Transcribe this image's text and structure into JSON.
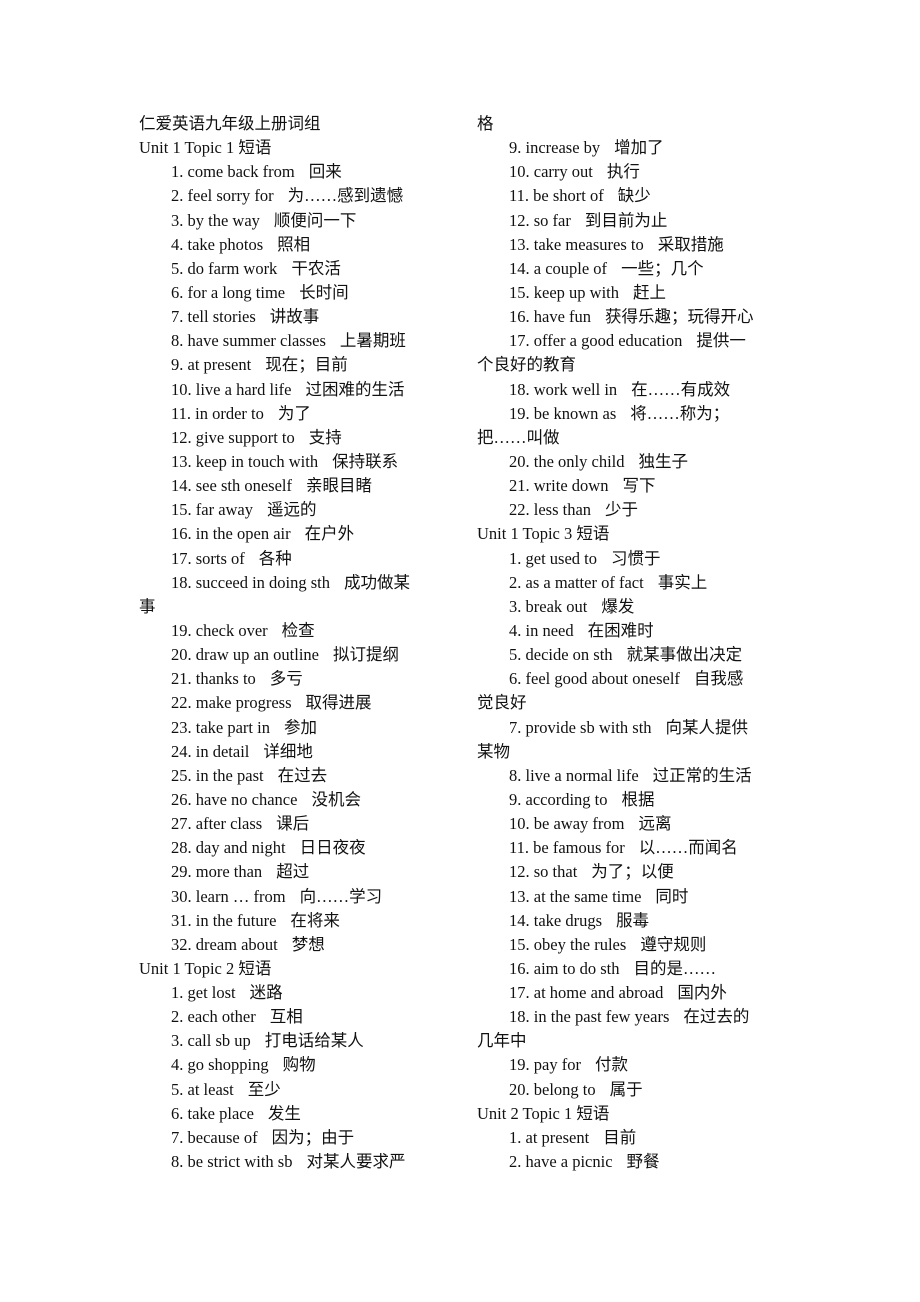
{
  "document": {
    "title": "仁爱英语九年级上册词组",
    "left_column": [
      {
        "type": "title",
        "text": "仁爱英语九年级上册词组"
      },
      {
        "type": "heading",
        "text": "Unit 1 Topic 1 短语"
      },
      {
        "type": "item",
        "num": "1.",
        "en": "come back from",
        "cn": "回来"
      },
      {
        "type": "item",
        "num": "2.",
        "en": "feel sorry for",
        "cn": "为……感到遗憾"
      },
      {
        "type": "item",
        "num": "3.",
        "en": "by the way",
        "cn": "顺便问一下"
      },
      {
        "type": "item",
        "num": "4.",
        "en": "take photos",
        "cn": "照相"
      },
      {
        "type": "item",
        "num": "5.",
        "en": "do farm work",
        "cn": "干农活"
      },
      {
        "type": "item",
        "num": "6.",
        "en": "for a long time",
        "cn": "长时间"
      },
      {
        "type": "item",
        "num": "7.",
        "en": "tell stories",
        "cn": "讲故事"
      },
      {
        "type": "item",
        "num": "8.",
        "en": "have summer classes",
        "cn": "上暑期班"
      },
      {
        "type": "item",
        "num": "9.",
        "en": "at present",
        "cn": "现在；目前"
      },
      {
        "type": "item",
        "num": "10.",
        "en": "live a hard life",
        "cn": "过困难的生活"
      },
      {
        "type": "item",
        "num": "11.",
        "en": "in order to",
        "cn": "为了"
      },
      {
        "type": "item",
        "num": "12.",
        "en": "give support to",
        "cn": "支持"
      },
      {
        "type": "item",
        "num": "13.",
        "en": "keep in touch with",
        "cn": "保持联系"
      },
      {
        "type": "item",
        "num": "14.",
        "en": "see sth oneself",
        "cn": "亲眼目睹"
      },
      {
        "type": "item",
        "num": "15.",
        "en": "far away",
        "cn": "遥远的"
      },
      {
        "type": "item",
        "num": "16.",
        "en": "in the open air",
        "cn": "在户外"
      },
      {
        "type": "item",
        "num": "17.",
        "en": "sorts of",
        "cn": "各种"
      },
      {
        "type": "item",
        "num": "18.",
        "en": "succeed in doing sth",
        "cn": "成功做某"
      },
      {
        "type": "wrap",
        "text": "事"
      },
      {
        "type": "item",
        "num": "19.",
        "en": "check over",
        "cn": "检查"
      },
      {
        "type": "item",
        "num": "20.",
        "en": "draw up an outline",
        "cn": "拟订提纲"
      },
      {
        "type": "item",
        "num": "21.",
        "en": "thanks to",
        "cn": "多亏"
      },
      {
        "type": "item",
        "num": "22.",
        "en": "make progress",
        "cn": "取得进展"
      },
      {
        "type": "item",
        "num": "23.",
        "en": "take part in",
        "cn": "参加"
      },
      {
        "type": "item",
        "num": "24.",
        "en": "in detail",
        "cn": "详细地"
      },
      {
        "type": "item",
        "num": "25.",
        "en": "in the past",
        "cn": "在过去"
      },
      {
        "type": "item",
        "num": "26.",
        "en": "have no chance",
        "cn": "没机会"
      },
      {
        "type": "item",
        "num": "27.",
        "en": "after class",
        "cn": "课后"
      },
      {
        "type": "item",
        "num": "28.",
        "en": "day and night",
        "cn": "日日夜夜"
      },
      {
        "type": "item",
        "num": "29.",
        "en": "more than",
        "cn": "超过"
      },
      {
        "type": "item",
        "num": "30.",
        "en": "learn … from",
        "cn": "向……学习"
      },
      {
        "type": "item",
        "num": "31.",
        "en": "in the future",
        "cn": "在将来"
      },
      {
        "type": "item",
        "num": "32.",
        "en": "dream about",
        "cn": "梦想"
      },
      {
        "type": "heading",
        "text": "Unit 1 Topic 2 短语"
      },
      {
        "type": "item",
        "num": "1.",
        "en": "get lost",
        "cn": "迷路"
      },
      {
        "type": "item",
        "num": "2.",
        "en": "each other",
        "cn": "互相"
      },
      {
        "type": "item",
        "num": "3.",
        "en": "call sb up",
        "cn": "打电话给某人"
      },
      {
        "type": "item",
        "num": "4.",
        "en": "go shopping",
        "cn": "购物"
      },
      {
        "type": "item",
        "num": "5.",
        "en": "at least",
        "cn": "至少"
      },
      {
        "type": "item",
        "num": "6.",
        "en": "take place",
        "cn": "发生"
      },
      {
        "type": "item",
        "num": "7.",
        "en": "because of",
        "cn": "因为；由于"
      },
      {
        "type": "item",
        "num": "8.",
        "en": "be strict with sb",
        "cn": "对某人要求严"
      }
    ],
    "right_column": [
      {
        "type": "wrap",
        "text": "格"
      },
      {
        "type": "item",
        "num": "9.",
        "en": "increase by",
        "cn": "增加了"
      },
      {
        "type": "item",
        "num": "10.",
        "en": "carry out",
        "cn": "执行"
      },
      {
        "type": "item",
        "num": "11.",
        "en": "be short of",
        "cn": "缺少"
      },
      {
        "type": "item",
        "num": "12.",
        "en": "so far",
        "cn": "到目前为止"
      },
      {
        "type": "item",
        "num": "13.",
        "en": "take measures to",
        "cn": "采取措施"
      },
      {
        "type": "item",
        "num": "14.",
        "en": "a couple of",
        "cn": "一些；几个"
      },
      {
        "type": "item",
        "num": "15.",
        "en": "keep up with",
        "cn": "赶上"
      },
      {
        "type": "item",
        "num": "16.",
        "en": "have fun",
        "cn": "获得乐趣；玩得开心"
      },
      {
        "type": "item",
        "num": "17.",
        "en": "offer a good education",
        "cn": "提供一"
      },
      {
        "type": "wrap",
        "text": "个良好的教育"
      },
      {
        "type": "item",
        "num": "18.",
        "en": "work well in",
        "cn": "在……有成效"
      },
      {
        "type": "item",
        "num": "19.",
        "en": "be known as",
        "cn": "将……称为；"
      },
      {
        "type": "wrap",
        "text": "把……叫做"
      },
      {
        "type": "item",
        "num": "20.",
        "en": "the only child",
        "cn": "独生子"
      },
      {
        "type": "item",
        "num": "21.",
        "en": "write down",
        "cn": "写下"
      },
      {
        "type": "item",
        "num": "22.",
        "en": "less than",
        "cn": "少于"
      },
      {
        "type": "heading",
        "text": "Unit 1 Topic 3 短语"
      },
      {
        "type": "item",
        "num": "1.",
        "en": "get used to",
        "cn": "习惯于"
      },
      {
        "type": "item",
        "num": "2.",
        "en": "as a matter of fact",
        "cn": "事实上"
      },
      {
        "type": "item",
        "num": "3.",
        "en": "break out",
        "cn": "爆发"
      },
      {
        "type": "item",
        "num": "4.",
        "en": "in need",
        "cn": "在困难时"
      },
      {
        "type": "item",
        "num": "5.",
        "en": "decide on sth",
        "cn": "就某事做出决定"
      },
      {
        "type": "item",
        "num": "6.",
        "en": "feel good about oneself",
        "cn": "自我感"
      },
      {
        "type": "wrap",
        "text": "觉良好"
      },
      {
        "type": "item",
        "num": "7.",
        "en": "provide sb with sth",
        "cn": "向某人提供"
      },
      {
        "type": "wrap",
        "text": "某物"
      },
      {
        "type": "item",
        "num": "8.",
        "en": "live a normal life",
        "cn": "过正常的生活"
      },
      {
        "type": "item",
        "num": "9.",
        "en": "according to",
        "cn": "根据"
      },
      {
        "type": "item",
        "num": "10.",
        "en": "be away from",
        "cn": "远离"
      },
      {
        "type": "item",
        "num": "11.",
        "en": "be famous for",
        "cn": "以……而闻名"
      },
      {
        "type": "item",
        "num": "12.",
        "en": "so that",
        "cn": "为了；以便"
      },
      {
        "type": "item",
        "num": "13.",
        "en": "at the same time",
        "cn": "同时"
      },
      {
        "type": "item",
        "num": "14.",
        "en": "take drugs",
        "cn": "服毒"
      },
      {
        "type": "item",
        "num": "15.",
        "en": "obey the rules",
        "cn": "遵守规则"
      },
      {
        "type": "item",
        "num": "16.",
        "en": "aim to do sth",
        "cn": "目的是……"
      },
      {
        "type": "item",
        "num": "17.",
        "en": "at home and abroad",
        "cn": "国内外"
      },
      {
        "type": "item",
        "num": "18.",
        "en": "in the past few years",
        "cn": "在过去的"
      },
      {
        "type": "wrap",
        "text": "几年中"
      },
      {
        "type": "item",
        "num": "19.",
        "en": "pay for",
        "cn": "付款"
      },
      {
        "type": "item",
        "num": "20.",
        "en": "belong to",
        "cn": "属于"
      },
      {
        "type": "heading",
        "text": "Unit 2 Topic 1 短语"
      },
      {
        "type": "item",
        "num": "1.",
        "en": "at present",
        "cn": "目前"
      },
      {
        "type": "item",
        "num": "2.",
        "en": "have a picnic",
        "cn": "野餐"
      }
    ]
  }
}
